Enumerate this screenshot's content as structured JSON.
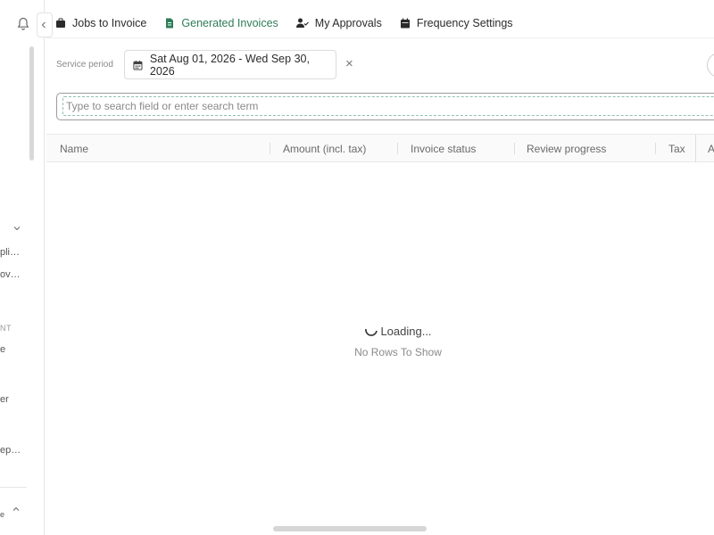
{
  "sidebar": {
    "texts": {
      "item1": "pli…",
      "item2": "ov…",
      "section": "NT",
      "item3": "e",
      "item4": "er",
      "item5": "ep…",
      "item6": "e"
    }
  },
  "tabs": [
    {
      "label": "Jobs to Invoice",
      "icon": "briefcase-icon"
    },
    {
      "label": "Generated Invoices",
      "icon": "invoice-icon",
      "active": true
    },
    {
      "label": "My Approvals",
      "icon": "user-check-icon"
    },
    {
      "label": "Frequency Settings",
      "icon": "calendar-icon"
    }
  ],
  "service_period": {
    "label": "Service period",
    "value": "Sat Aug 01, 2026 - Wed Sep 30, 2026",
    "clear": "×"
  },
  "search": {
    "placeholder": "Type to search field or enter search term",
    "value": ""
  },
  "grid": {
    "columns": [
      "Name",
      "Amount (incl. tax)",
      "Invoice status",
      "Review progress",
      "Tax",
      "A"
    ],
    "loading": "Loading...",
    "no_rows": "No Rows To Show"
  },
  "colors": {
    "accent": "#2e7d58",
    "text": "#2b2b2b",
    "muted": "#8a8a8a",
    "border": "#dcdcdc"
  }
}
